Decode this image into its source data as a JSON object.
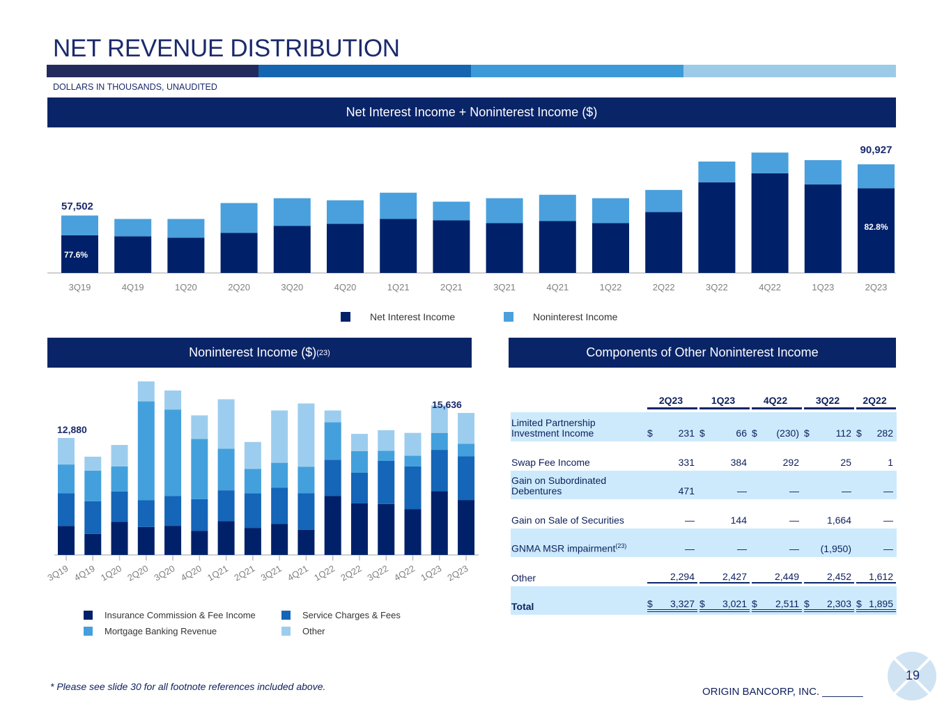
{
  "title": "NET REVENUE DISTRIBUTION",
  "subtitle": "DOLLARS IN THOUSANDS, UNAUDITED",
  "stripe_colors": [
    "#232a5c",
    "#1565b0",
    "#3d9ad8",
    "#9ccbea"
  ],
  "footnote": "* Please see slide 30 for all footnote references included above.",
  "company": "ORIGIN BANCORP, INC. _______",
  "page_number": "19",
  "chart_data": [
    {
      "type": "bar",
      "stacked": true,
      "title": "Net Interest Income + Noninterest Income ($)",
      "categories": [
        "3Q19",
        "4Q19",
        "1Q20",
        "2Q20",
        "3Q20",
        "4Q20",
        "1Q21",
        "2Q21",
        "3Q21",
        "4Q21",
        "1Q22",
        "2Q22",
        "3Q22",
        "4Q22",
        "1Q23",
        "2Q23"
      ],
      "series": [
        {
          "name": "Net Interest Income",
          "color": "#002169",
          "values": [
            44622,
            43950,
            43050,
            46200,
            50700,
            52100,
            55250,
            54350,
            52550,
            53900,
            52550,
            59750,
            79200,
            85050,
            77850,
            75288
          ]
        },
        {
          "name": "Noninterest Income",
          "color": "#4aa0dc",
          "values": [
            12880,
            11300,
            12200,
            19450,
            18100,
            15350,
            17150,
            12200,
            16250,
            17150,
            16250,
            14450,
            13550,
            13550,
            15800,
            15636
          ]
        }
      ],
      "total_labels": {
        "first": "57,502",
        "last": "90,927"
      },
      "percent_labels": {
        "first": "77.6%",
        "last": "82.8%"
      },
      "ylim": [
        20000,
        100000
      ],
      "legend": "bottom",
      "grid": false
    },
    {
      "type": "bar",
      "stacked": true,
      "title": "Noninterest Income ($)",
      "title_sup": "(23)",
      "categories": [
        "3Q19",
        "4Q19",
        "1Q20",
        "2Q20",
        "3Q20",
        "4Q20",
        "1Q21",
        "2Q21",
        "3Q21",
        "4Q21",
        "1Q22",
        "2Q22",
        "3Q22",
        "4Q22",
        "1Q23",
        "2Q23"
      ],
      "series": [
        {
          "name": "Insurance Commission & Fee Income",
          "color": "#00216a",
          "values": [
            3200,
            2320,
            3650,
            3080,
            3210,
            2650,
            3730,
            2980,
            3420,
            2780,
            6480,
            5680,
            5610,
            5050,
            7010,
            6050
          ]
        },
        {
          "name": "Service Charges & Fees",
          "color": "#1565b8",
          "values": [
            3600,
            3600,
            3340,
            2940,
            3270,
            3490,
            3390,
            3800,
            4000,
            4010,
            4000,
            3390,
            4740,
            4690,
            4560,
            4800
          ]
        },
        {
          "name": "Mortgage Banking Revenue",
          "color": "#43a0dc",
          "values": [
            3160,
            3370,
            2750,
            10890,
            9530,
            6630,
            4570,
            2700,
            2730,
            2930,
            4130,
            2370,
            1120,
            1180,
            1870,
            1400
          ]
        },
        {
          "name": "Other",
          "color": "#9dcdee",
          "values": [
            2920,
            1530,
            2370,
            2200,
            2100,
            2600,
            5450,
            2960,
            5760,
            6960,
            1300,
            1890,
            2270,
            2520,
            3030,
            3386
          ]
        }
      ],
      "total_labels": {
        "first": "12,880",
        "last": "15,636"
      },
      "ylim": [
        0,
        20000
      ],
      "legend": "bottom",
      "grid": false
    }
  ],
  "table": {
    "title": "Components of Other Noninterest Income",
    "columns": [
      "2Q23",
      "1Q23",
      "4Q22",
      "3Q22",
      "2Q22"
    ],
    "rows": [
      {
        "label": "Limited Partnership Investment Income",
        "cells": [
          [
            "$",
            "231"
          ],
          [
            "$",
            "66"
          ],
          [
            "$",
            "(230)"
          ],
          [
            "$",
            "112"
          ],
          [
            "$",
            "282"
          ]
        ]
      },
      {
        "label": "Swap Fee Income",
        "cells": [
          [
            "",
            "331"
          ],
          [
            "",
            "384"
          ],
          [
            "",
            "292"
          ],
          [
            "",
            "25"
          ],
          [
            "",
            "1"
          ]
        ]
      },
      {
        "label": "Gain on Subordinated Debentures",
        "cells": [
          [
            "",
            "471"
          ],
          [
            "",
            "—"
          ],
          [
            "",
            "—"
          ],
          [
            "",
            "—"
          ],
          [
            "",
            "—"
          ]
        ]
      },
      {
        "label": "Gain on Sale of Securities",
        "cells": [
          [
            "",
            "—"
          ],
          [
            "",
            "144"
          ],
          [
            "",
            "—"
          ],
          [
            "",
            "1,664"
          ],
          [
            "",
            "—"
          ]
        ]
      },
      {
        "label": "GNMA MSR impairment",
        "sup": "(23)",
        "cells": [
          [
            "",
            "—"
          ],
          [
            "",
            "—"
          ],
          [
            "",
            "—"
          ],
          [
            "",
            "(1,950)"
          ],
          [
            "",
            "—"
          ]
        ]
      },
      {
        "label": "Other",
        "cells": [
          [
            "",
            "2,294"
          ],
          [
            "",
            "2,427"
          ],
          [
            "",
            "2,449"
          ],
          [
            "",
            "2,452"
          ],
          [
            "",
            "1,612"
          ]
        ]
      },
      {
        "label": "Total",
        "cells": [
          [
            "$",
            "3,327"
          ],
          [
            "$",
            "3,021"
          ],
          [
            "$",
            "2,511"
          ],
          [
            "$",
            "2,303"
          ],
          [
            "$",
            "1,895"
          ]
        ]
      }
    ]
  }
}
